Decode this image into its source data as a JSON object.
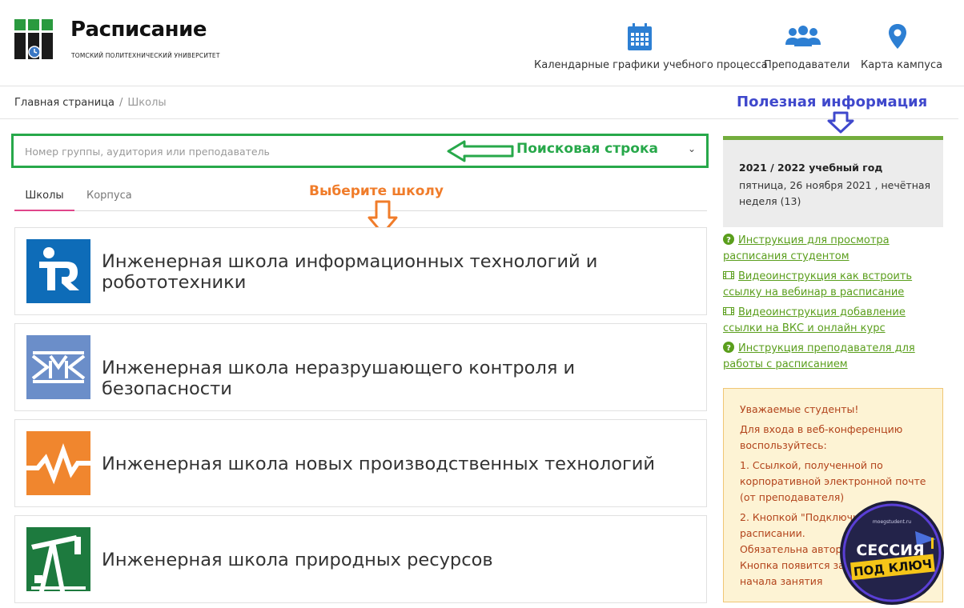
{
  "header": {
    "title": "Расписание",
    "subtitle": "ТОМСКИЙ ПОЛИТЕХНИЧЕСКИЙ УНИВЕРСИТЕТ",
    "nav": [
      {
        "label": "Календарные графики учебного процесса",
        "icon": "calendar-icon"
      },
      {
        "label": "Преподаватели",
        "icon": "users-icon"
      },
      {
        "label": "Карта кампуса",
        "icon": "map-pin-icon"
      }
    ]
  },
  "breadcrumb": {
    "home": "Главная страница",
    "separator": "/",
    "current": "Школы"
  },
  "search": {
    "placeholder": "Номер группы, аудитория или преподаватель",
    "annotation": "Поисковая строка"
  },
  "tabs": [
    {
      "label": "Школы",
      "active": true
    },
    {
      "label": "Корпуса",
      "active": false
    }
  ],
  "annotations": {
    "choose_school": "Выберите школу",
    "useful_info": "Полезная информация"
  },
  "schools": [
    {
      "name": "Инженерная школа информационных технологий и робототехники",
      "color": "#0e6cb8"
    },
    {
      "name": "Инженерная школа неразрушающего контроля и безопасности",
      "color": "#6b8ec9"
    },
    {
      "name": "Инженерная школа новых производственных технологий",
      "color": "#f0862e"
    },
    {
      "name": "Инженерная школа природных ресурсов",
      "color": "#1d7a3e"
    }
  ],
  "sidebar": {
    "year_title": "2021 / 2022 учебный год",
    "date": "пятница, 26 ноября 2021 , нечётная неделя (13)",
    "links": [
      {
        "label": "Инструкция для просмотра расписания студентом",
        "icon": "question-circle-icon"
      },
      {
        "label": "Видеоинструкция как встроить ссылку на вебинар в расписание",
        "icon": "video-film-icon"
      },
      {
        "label": "Видеоинструкция добавление ссылки на ВКС и онлайн курс",
        "icon": "video-film-icon"
      },
      {
        "label": "Инструкция преподавателя для работы с расписанием",
        "icon": "question-circle-icon"
      }
    ],
    "notice": {
      "greeting": "Уважаемые студенты!",
      "intro": "Для входа в веб-конференцию воспользуйтесь:",
      "item1": "1. Ссылкой, полученной по корпоративной электронной почте (от преподавателя)",
      "item2": "2. Кнопкой \"Подключи",
      "item2b": "расписании.",
      "item3": "Обязательна автори",
      "item4": "Кнопка появится за",
      "item5": "начала занятия"
    }
  },
  "badge": {
    "site": "moegstudent.ru",
    "line1": "СЕССИЯ",
    "line2": "ПОД КЛЮЧ"
  },
  "colors": {
    "green": "#27a84a",
    "orange": "#f07c2a",
    "blue": "#3f48cc",
    "link": "#5a9e1c",
    "accent_bar": "#73ad3d"
  }
}
